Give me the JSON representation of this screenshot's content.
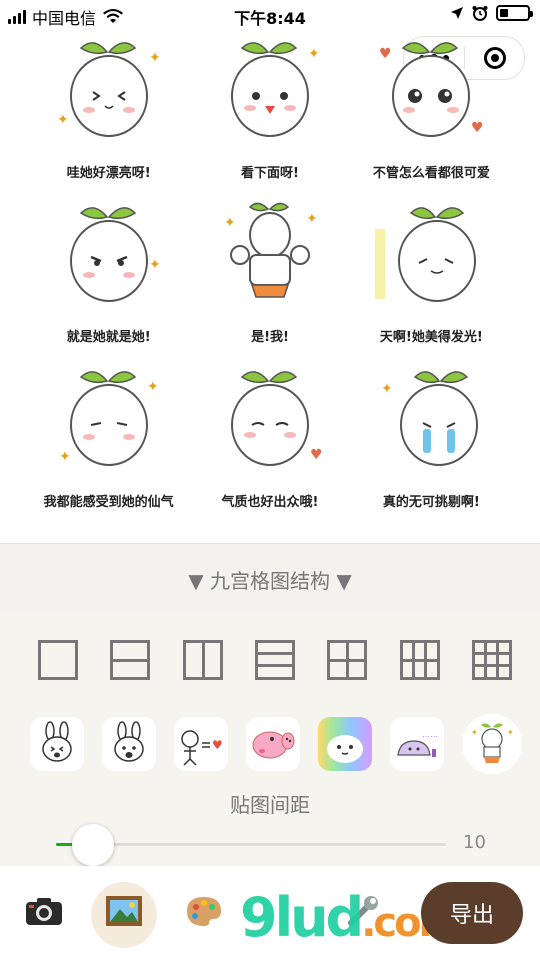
{
  "status_bar": {
    "carrier": "中国电信",
    "time": "下午8:44",
    "battery_level": 0.3
  },
  "capsule": {
    "more_icon": "more-dots-icon",
    "close_icon": "target-circle-icon"
  },
  "grid_cells": [
    {
      "caption": "哇她好漂亮呀!"
    },
    {
      "caption": "看下面呀!"
    },
    {
      "caption": "不管怎么看都很可爱"
    },
    {
      "caption": "就是她就是她!"
    },
    {
      "caption": "是!我!"
    },
    {
      "caption": "天啊!她美得发光!"
    },
    {
      "caption": "我都能感受到她的仙气"
    },
    {
      "caption": "气质也好出众哦!"
    },
    {
      "caption": "真的无可挑剔啊!"
    }
  ],
  "structure": {
    "label": "▼ 九宫格图结构 ▼"
  },
  "layouts": [
    "single",
    "two-rows",
    "two-cols",
    "three-rows",
    "four-grid",
    "six-grid",
    "nine-grid"
  ],
  "stickers": [
    "rabbit-sticker",
    "rabbit-sticker-2",
    "cartoon-equals-heart-sticker",
    "peppa-pig-sticker",
    "rainbow-cloud-sticker",
    "purple-ghost-sticker",
    "sprout-dancer-sticker"
  ],
  "spacing": {
    "label": "贴图间距",
    "value": "10"
  },
  "tabbar": {
    "camera_icon": "camera-icon",
    "picture_icon": "picture-icon",
    "palette_icon": "palette-icon",
    "tool_icon": "wrench-icon",
    "export_label": "导出"
  },
  "watermark": {
    "text": "9lud",
    "suffix": ".com"
  },
  "colors": {
    "accent_green": "#1aad19",
    "export_bg": "#5a3e2b",
    "panel_bg": "#f6f4ee"
  }
}
